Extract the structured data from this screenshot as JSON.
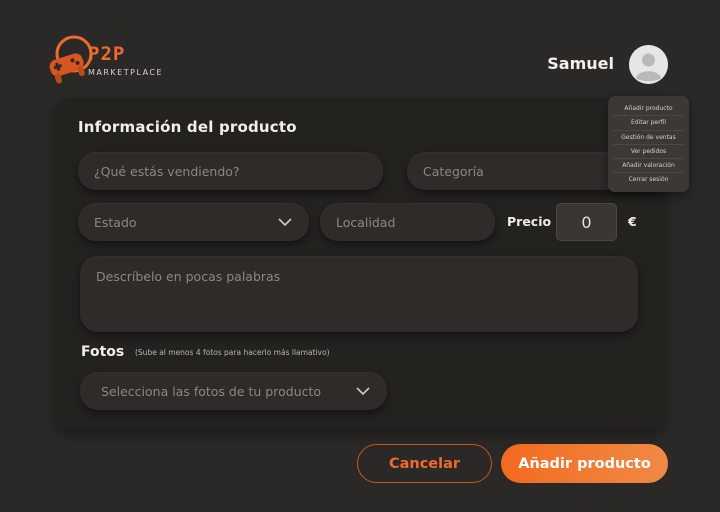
{
  "brand": {
    "name": "P2P",
    "subtitle": "MARKETPLACE",
    "accent_color": "#ef6a2c",
    "logo_icon": "gamepad-icon"
  },
  "header": {
    "user_name": "Samuel",
    "avatar_icon": "user-avatar-icon"
  },
  "user_menu": {
    "items": [
      {
        "label": "Añadir producto"
      },
      {
        "label": "Editar perfil"
      },
      {
        "label": "Gestión de ventas"
      },
      {
        "label": "Ver pedidos"
      },
      {
        "label": "Añadir valoración"
      },
      {
        "label": "Cerrar sesión"
      }
    ]
  },
  "form": {
    "title": "Información del producto",
    "what_selling": {
      "placeholder": "¿Qué estás vendiendo?",
      "value": ""
    },
    "category": {
      "placeholder": "Categoría",
      "value": ""
    },
    "condition": {
      "placeholder": "Estado",
      "value": ""
    },
    "location": {
      "placeholder": "Localidad",
      "value": ""
    },
    "price": {
      "label": "Precio",
      "value": "0",
      "currency": "€"
    },
    "description": {
      "placeholder": "Descríbelo en pocas palabras",
      "value": ""
    },
    "photos": {
      "label": "Fotos",
      "hint": "(Sube al menos 4 fotos para hacerlo más llamativo)",
      "placeholder": "Selecciona las fotos de tu producto"
    }
  },
  "actions": {
    "cancel_label": "Cancelar",
    "submit_label": "Añadir producto"
  },
  "colors": {
    "background": "#2b2927",
    "card": "#24221f",
    "field": "#2e2b28",
    "accent": "#ef6a2c"
  }
}
